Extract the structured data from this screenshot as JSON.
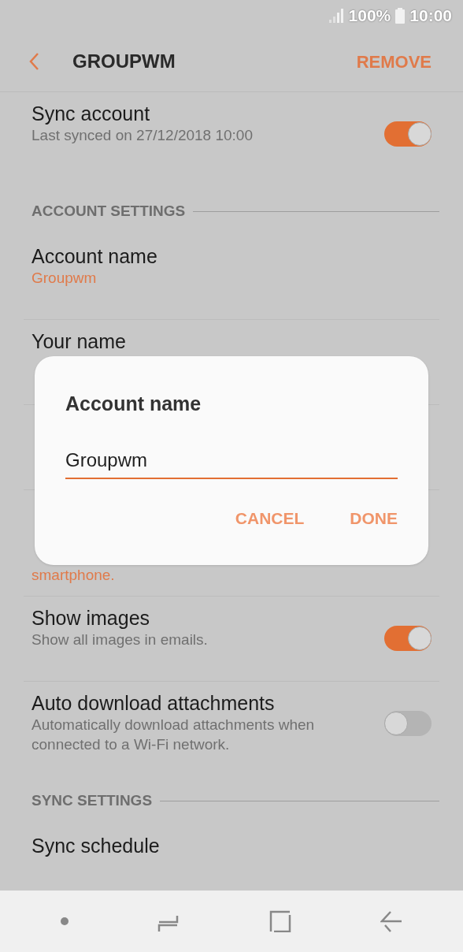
{
  "status_bar": {
    "battery": "100%",
    "time": "10:00"
  },
  "header": {
    "title": "GROUPWM",
    "action": "REMOVE"
  },
  "sections": [
    {
      "rows": [
        {
          "kind": "switch",
          "title": "Sync account",
          "description": "Last synced on 27/12/2018  10:00",
          "on": true
        }
      ]
    },
    {
      "title": "ACCOUNT SETTINGS",
      "rows": [
        {
          "kind": "plain",
          "title": "Account name",
          "value": "Groupwm"
        },
        {
          "kind": "plain",
          "title": "Your name"
        },
        {
          "kind": "plain"
        },
        {
          "kind": "plain",
          "value_lines": [
            "smartphone."
          ]
        },
        {
          "kind": "switch",
          "title": "Show images",
          "description": "Show all images in emails.",
          "on": true
        },
        {
          "kind": "switch",
          "title": "Auto download attachments",
          "description": "Automatically download attachments when connected to a Wi-Fi network.",
          "on": false
        }
      ]
    },
    {
      "title": "SYNC SETTINGS",
      "rows": [
        {
          "kind": "plain",
          "title": "Sync schedule"
        }
      ]
    }
  ],
  "dialog": {
    "title": "Account name",
    "value": "Groupwm",
    "buttons": [
      "CANCEL",
      "DONE"
    ]
  }
}
